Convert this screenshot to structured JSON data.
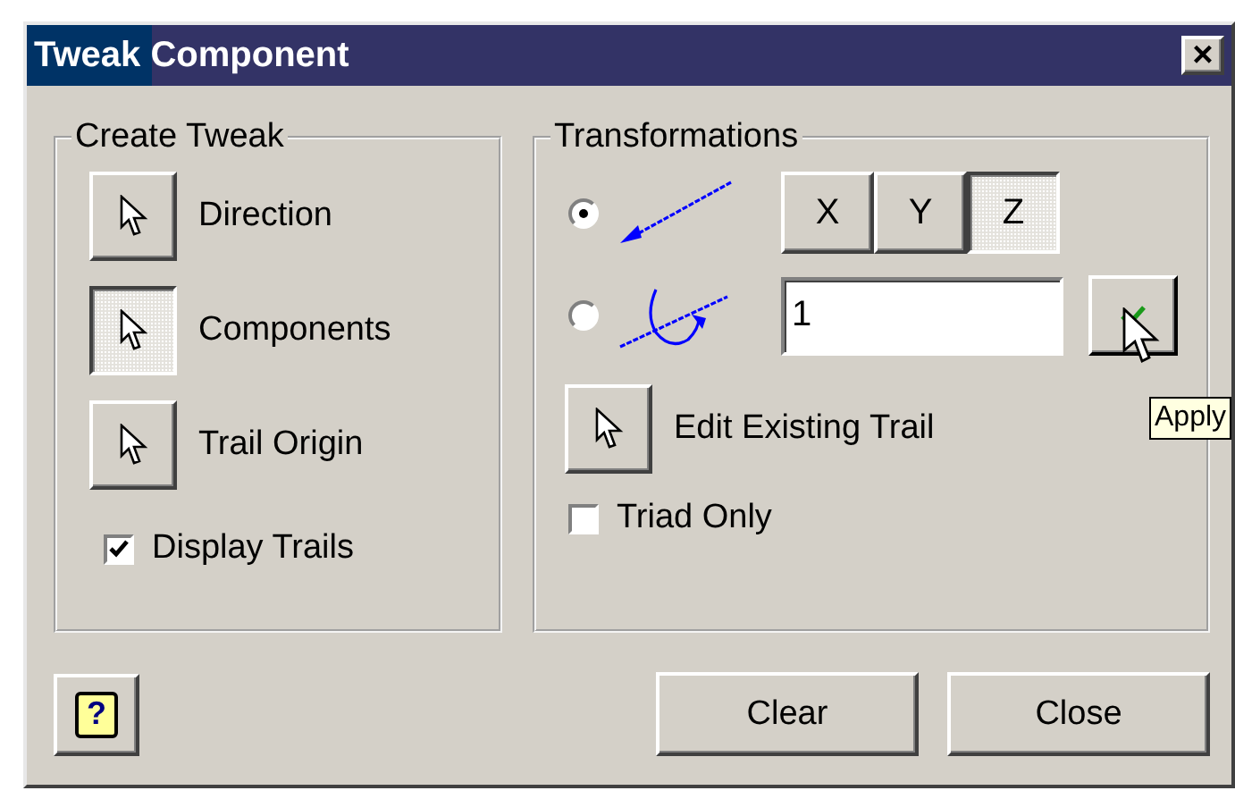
{
  "window": {
    "title": "Tweak Component",
    "close_label": "×"
  },
  "create_tweak": {
    "title": "Create Tweak",
    "picks": [
      {
        "label": "Direction",
        "selected": false
      },
      {
        "label": "Components",
        "selected": true
      },
      {
        "label": "Trail Origin",
        "selected": false
      }
    ],
    "display_trails": {
      "label": "Display Trails",
      "checked": true
    }
  },
  "transformations": {
    "title": "Transformations",
    "modes": [
      {
        "kind": "move",
        "selected": true
      },
      {
        "kind": "rotate",
        "selected": false
      }
    ],
    "axes": [
      {
        "label": "X",
        "selected": false
      },
      {
        "label": "Y",
        "selected": false
      },
      {
        "label": "Z",
        "selected": true
      }
    ],
    "value": "1",
    "apply_tooltip": "Apply",
    "edit_trail": "Edit Existing Trail",
    "triad_only": {
      "label": "Triad Only",
      "checked": false
    }
  },
  "help": "?",
  "buttons": [
    "Clear",
    "Close"
  ]
}
